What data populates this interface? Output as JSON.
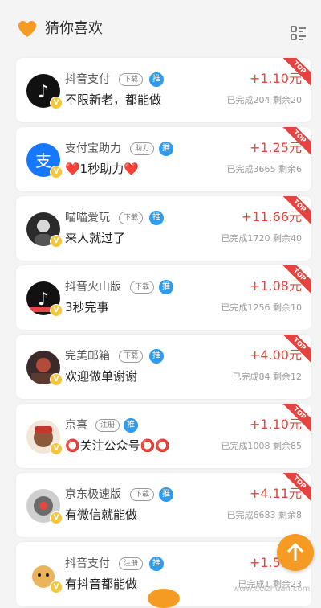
{
  "header": {
    "title": "猜你喜欢",
    "menu_icon": "grid-list-icon"
  },
  "colors": {
    "accent": "#e8463c",
    "tui_badge": "#2f9bee",
    "logo": "#f59a23"
  },
  "tasks": [
    {
      "name": "抖音支付",
      "tag": "下载",
      "has_tui": true,
      "desc": "不限新老，都能做",
      "price": "+1.10元",
      "stats": "已完成204 剩余20",
      "avatar": "tiktok-avatar"
    },
    {
      "name": "支付宝助力",
      "tag": "助力",
      "has_tui": true,
      "desc": "❤️1秒助力❤️",
      "price": "+1.25元",
      "stats": "已完成3665 剩余6",
      "avatar": "alipay-avatar"
    },
    {
      "name": "喵喵爱玩",
      "tag": "下载",
      "has_tui": true,
      "desc": "来人就过了",
      "price": "+11.66元",
      "stats": "已完成1720 剩余40",
      "avatar": "user-avatar"
    },
    {
      "name": "抖音火山版",
      "tag": "下载",
      "has_tui": true,
      "desc": "3秒完事",
      "price": "+1.08元",
      "stats": "已完成1256 剩余10",
      "avatar": "tiktok-avatar"
    },
    {
      "name": "完美邮箱",
      "tag": "下载",
      "has_tui": true,
      "desc": "欢迎做单谢谢",
      "price": "+4.00元",
      "stats": "已完成84 剩余12",
      "avatar": "user-avatar"
    },
    {
      "name": "京喜",
      "tag": "注册",
      "has_tui": true,
      "desc": "⭕关注公众号⭕⭕",
      "price": "+1.10元",
      "stats": "已完成1008 剩余85",
      "avatar": "user-avatar"
    },
    {
      "name": "京东极速版",
      "tag": "下载",
      "has_tui": true,
      "desc": "有微信就能做",
      "price": "+4.11元",
      "stats": "已完成6683 剩余8",
      "avatar": "user-avatar"
    },
    {
      "name": "抖音支付",
      "tag": "注册",
      "has_tui": true,
      "desc": "有抖音都能做",
      "price": "+1.58元",
      "stats": "已完成1 剩余23",
      "avatar": "doge-avatar"
    }
  ],
  "badges": {
    "top": "TOP",
    "tui": "推",
    "verified": "V"
  },
  "floating": {
    "scroll_top_icon": "arrow-up-icon"
  },
  "watermark": "www.ucizhuan.com"
}
